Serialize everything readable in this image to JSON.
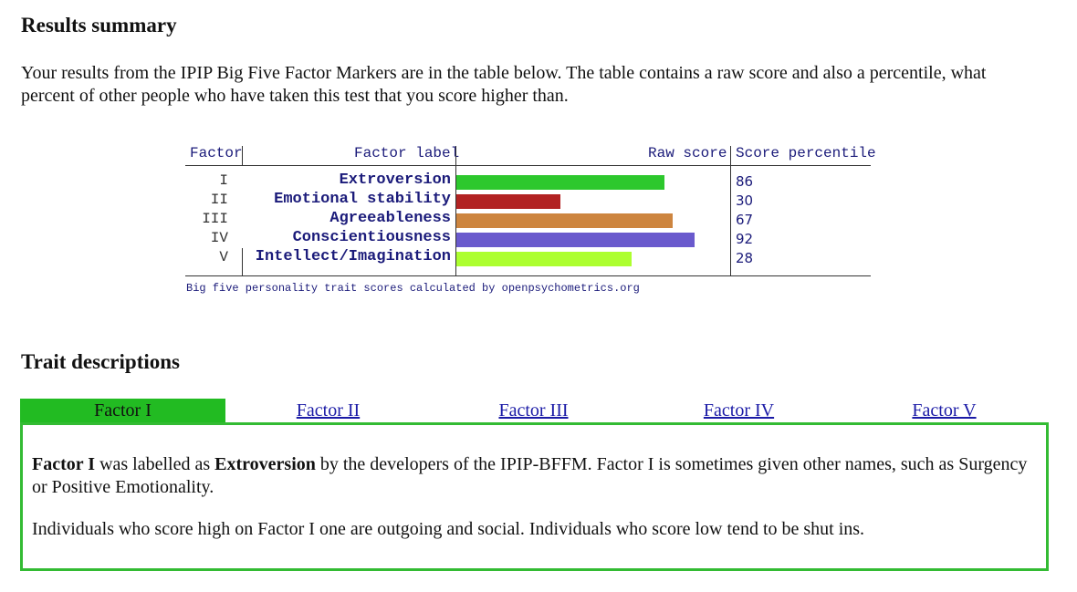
{
  "results": {
    "heading": "Results summary",
    "intro": "Your results from the IPIP Big Five Factor Markers are in the table below. The table contains a raw score and also a percentile, what percent of other people who have taken this test that you score higher than.",
    "table": {
      "headers": {
        "factor": "Factor",
        "label": "Factor label",
        "raw": "Raw score",
        "percentile": "Score percentile"
      },
      "caption": "Big five personality trait scores calculated by openpsychometrics.org"
    }
  },
  "chart_data": {
    "type": "bar",
    "categories": [
      "Extroversion",
      "Emotional stability",
      "Agreeableness",
      "Conscientiousness",
      "Intellect/Imagination"
    ],
    "factors": [
      "I",
      "II",
      "III",
      "IV",
      "V"
    ],
    "values": [
      86,
      30,
      67,
      92,
      28
    ],
    "raw_scores_relative": [
      0.76,
      0.38,
      0.79,
      0.87,
      0.64
    ],
    "colors": [
      "#2dc82d",
      "#b22222",
      "#cd853f",
      "#6a5acd",
      "#adff2f"
    ],
    "xlabel": "Raw score",
    "ylabel": "Factor label"
  },
  "traits": {
    "heading": "Trait descriptions",
    "tabs": [
      "Factor I",
      "Factor II",
      "Factor III",
      "Factor IV",
      "Factor V"
    ],
    "active_tab": 0,
    "accent_color": "#22bb22",
    "panel": {
      "p1_strong1": "Factor I",
      "p1_mid": " was labelled as ",
      "p1_strong2": "Extroversion",
      "p1_rest": " by the developers of the IPIP-BFFM. Factor I is sometimes given other names, such as Surgency or Positive Emotionality.",
      "p2": "Individuals who score high on Factor I one are outgoing and social. Individuals who score low tend to be shut ins."
    }
  }
}
